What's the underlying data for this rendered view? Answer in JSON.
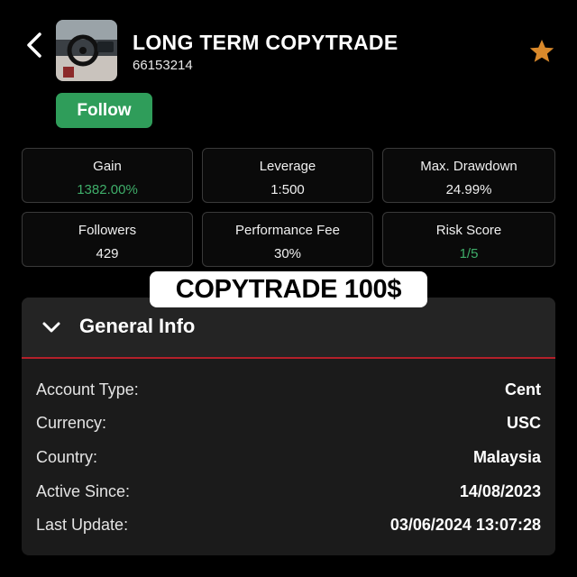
{
  "header": {
    "title": "LONG TERM COPYTRADE",
    "account_id": "66153214",
    "follow_label": "Follow",
    "back_icon": "chevron-left-icon",
    "favorite_icon": "star-icon",
    "favorite_color": "#d9892b"
  },
  "stats": [
    {
      "label": "Gain",
      "value": "1382.00%",
      "highlight": true
    },
    {
      "label": "Leverage",
      "value": "1:500",
      "highlight": false
    },
    {
      "label": "Max. Drawdown",
      "value": "24.99%",
      "highlight": false
    },
    {
      "label": "Followers",
      "value": "429",
      "highlight": false
    },
    {
      "label": "Performance Fee",
      "value": "30%",
      "highlight": false
    },
    {
      "label": "Risk Score",
      "value": "1/5",
      "highlight": true
    }
  ],
  "banner": "COPYTRADE 100$",
  "general_info": {
    "title": "General Info",
    "toggle_icon": "chevron-down-icon",
    "rows": [
      {
        "label": "Account Type:",
        "value": "Cent"
      },
      {
        "label": "Currency:",
        "value": "USC"
      },
      {
        "label": "Country:",
        "value": "Malaysia"
      },
      {
        "label": "Active Since:",
        "value": "14/08/2023"
      },
      {
        "label": "Last Update:",
        "value": "03/06/2024 13:07:28"
      }
    ]
  },
  "colors": {
    "positive": "#3fae6a",
    "follow": "#2f9d5a",
    "divider": "#b3202a"
  }
}
